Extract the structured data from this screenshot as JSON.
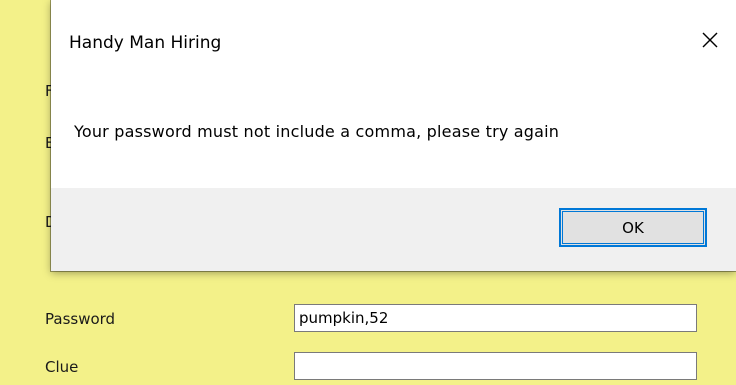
{
  "form": {
    "partial_labels": [
      "F",
      "E",
      "D"
    ],
    "password_label": "Password",
    "password_value": "pumpkin,52",
    "clue_label": "Clue",
    "clue_value": ""
  },
  "dialog": {
    "title": "Handy Man Hiring",
    "message": "Your password must not include a comma, please try again",
    "ok_label": "OK",
    "close_icon": "close-icon"
  },
  "colors": {
    "form_background": "#f3f189",
    "dialog_footer": "#f0f0f0",
    "button_focus_border": "#0078d7"
  }
}
